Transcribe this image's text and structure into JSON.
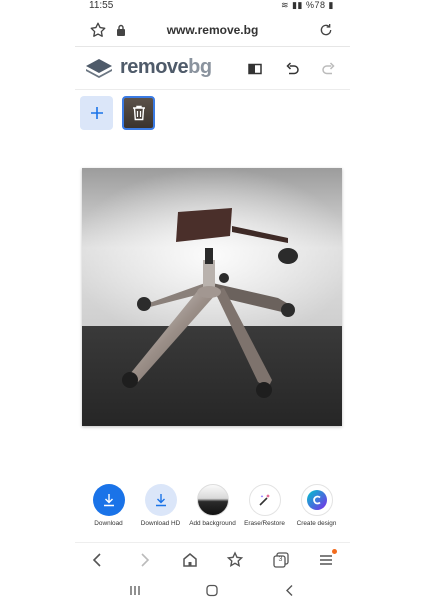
{
  "status_bar": {
    "time": "11:55",
    "indicators": "%78"
  },
  "address_bar": {
    "url": "www.remove.bg"
  },
  "app_header": {
    "brand": {
      "part1": "remove",
      "part2": "bg"
    }
  },
  "thumbnails": {
    "add_icon": "plus-icon",
    "selected_overlay_icon": "trash-icon"
  },
  "actions": [
    {
      "label": "Download",
      "icon": "download-icon",
      "color": "#1a73e8"
    },
    {
      "label": "Download HD",
      "icon": "download-icon",
      "color": "#dbe6f9"
    },
    {
      "label": "Add background",
      "icon": "background-swatch-icon"
    },
    {
      "label": "Erase/Restore",
      "icon": "magic-brush-icon"
    },
    {
      "label": "Create design",
      "icon": "canva-icon"
    }
  ],
  "browser_nav": {
    "tabs_count": "3"
  }
}
